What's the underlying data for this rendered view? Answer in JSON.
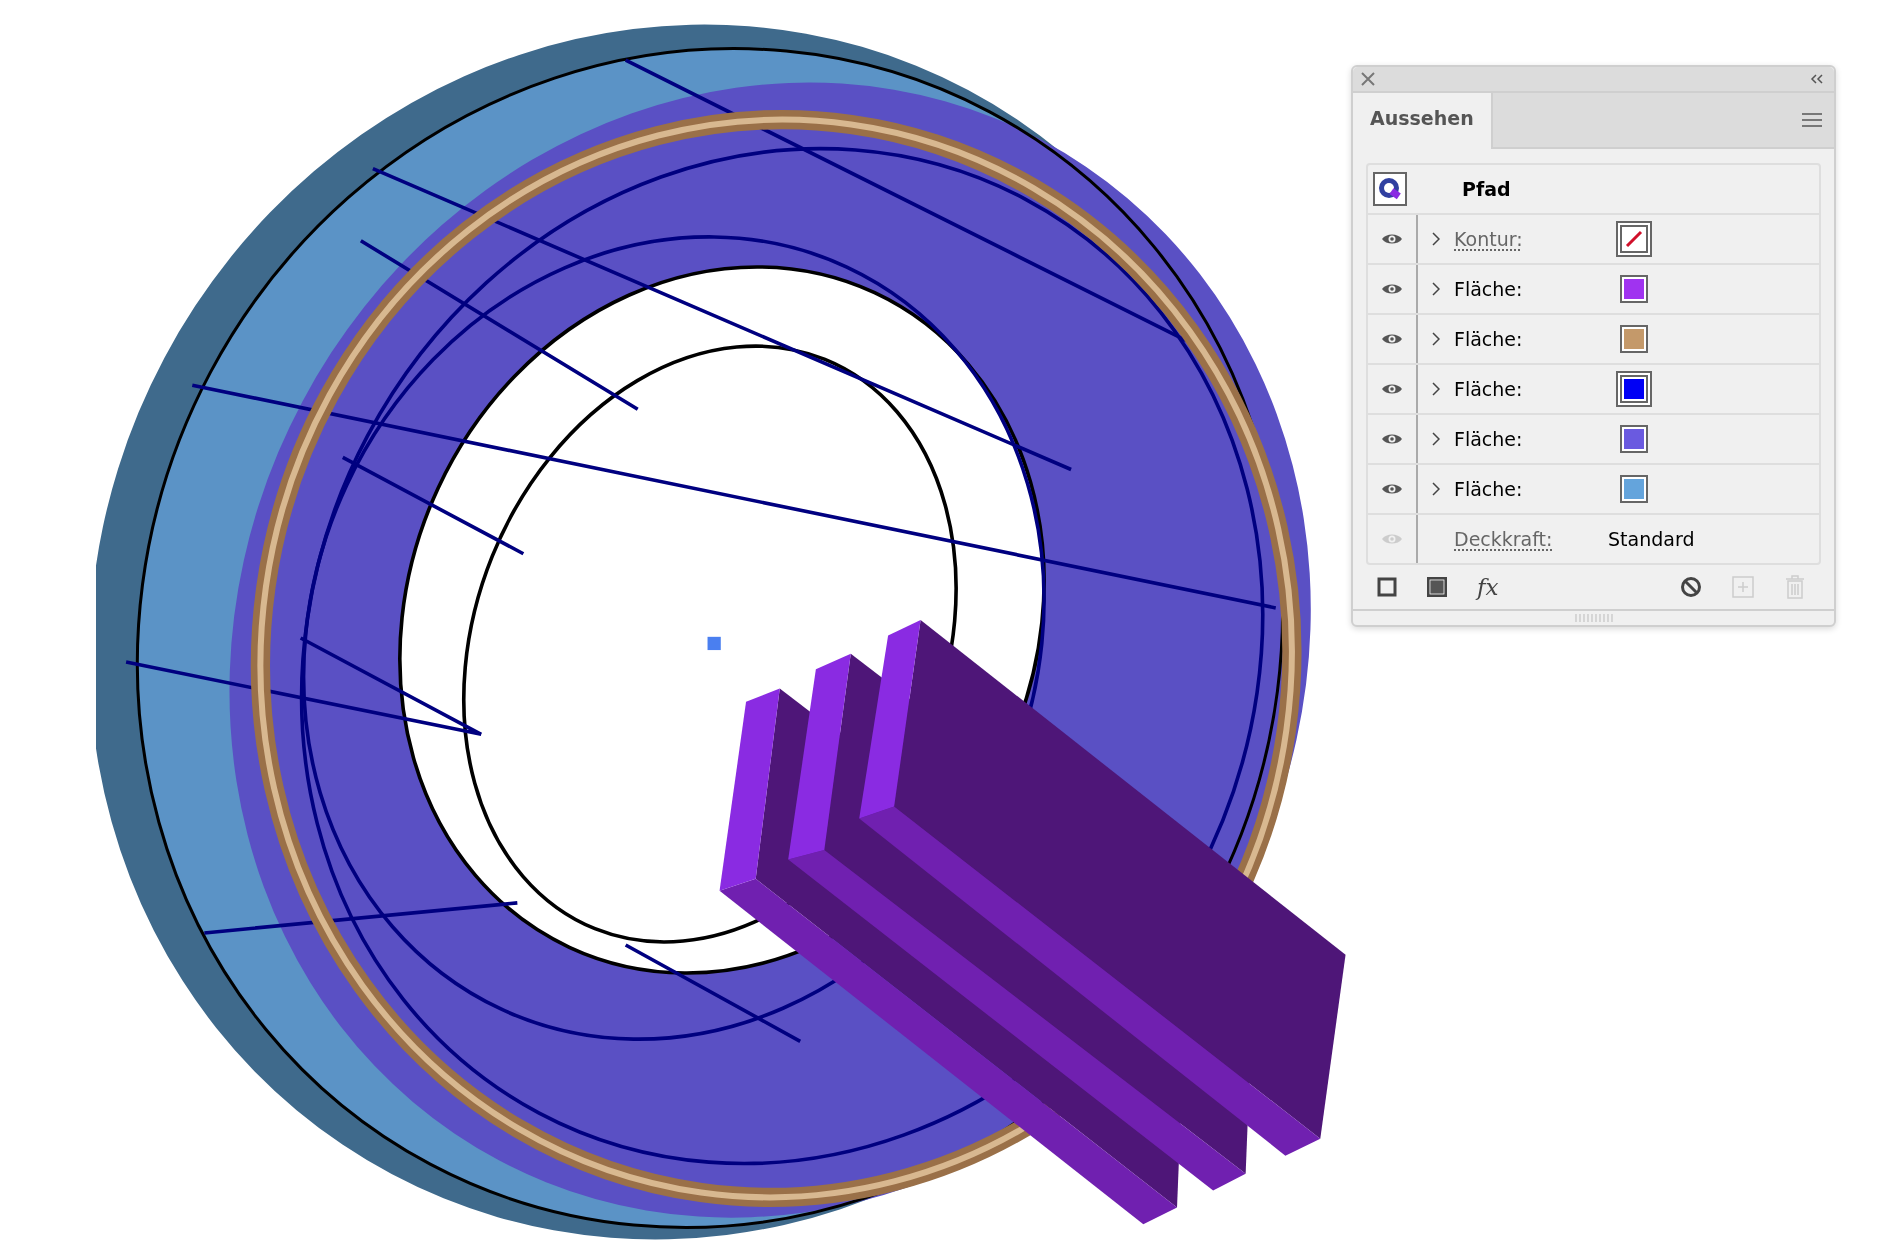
{
  "panel": {
    "tab": {
      "label": "Aussehen",
      "selected": true
    },
    "header": {
      "title": "Pfad"
    },
    "rows": [
      {
        "kind": "stroke",
        "label": "Kontur:",
        "visible": true,
        "active": true
      },
      {
        "kind": "fill",
        "label": "Fläche:",
        "visible": true,
        "active": false,
        "color": "#a033f0"
      },
      {
        "kind": "fill",
        "label": "Fläche:",
        "visible": true,
        "active": false,
        "color": "#c4996a"
      },
      {
        "kind": "fill",
        "label": "Fläche:",
        "visible": true,
        "active": true,
        "color": "#0000f5"
      },
      {
        "kind": "fill",
        "label": "Fläche:",
        "visible": true,
        "active": false,
        "color": "#6a5ae0"
      },
      {
        "kind": "fill",
        "label": "Fläche:",
        "visible": true,
        "active": false,
        "color": "#64a4dc"
      }
    ],
    "opacity": {
      "label": "Deckkraft:",
      "value": "Standard",
      "visible": false
    },
    "fx_button": {
      "label": "fx"
    }
  }
}
